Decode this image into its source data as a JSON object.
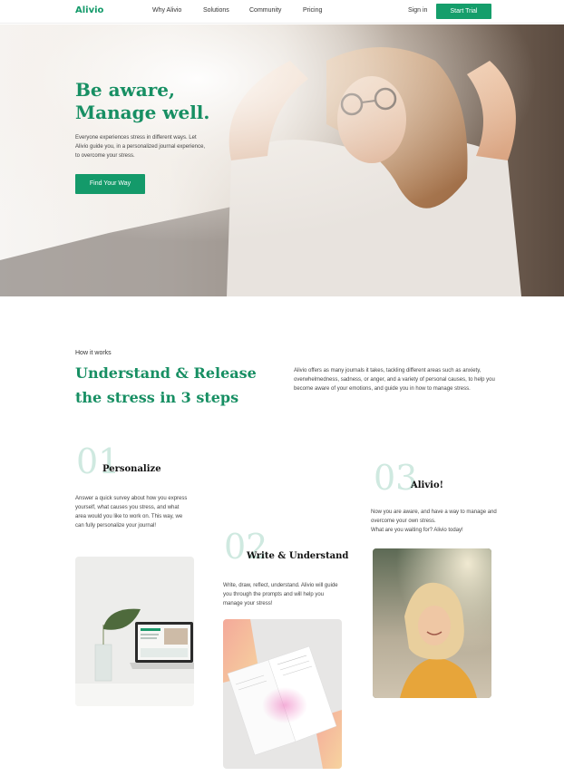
{
  "nav": {
    "logo": "Alivio",
    "links": [
      "Why Alivio",
      "Solutions",
      "Community",
      "Pricing"
    ],
    "sign_in": "Sign in",
    "start_trial": "Start Trial"
  },
  "hero": {
    "title_line1": "Be aware,",
    "title_line2": "Manage well.",
    "subtitle": "Everyone experiences stress in different ways. Let Alivio guide you, in a personalized journal experience, to overcome your stress.",
    "cta": "Find Your Way"
  },
  "how": {
    "label": "How it works",
    "title_line1": "Understand & Release",
    "title_line2": "the stress in 3 steps",
    "description": "Alivio offers as many journals it takes, tackling different areas such as anxiety, overwhelmedness, sadness, or anger, and a variety of personal causes, to help you become aware of your emotions, and guide you in how to manage stress."
  },
  "steps": [
    {
      "number": "01",
      "title": "Personalize",
      "text": "Answer a quick survey about how you express yourself, what causes you stress, and what area would you like to work on. This way, we can fully personalize your journal!"
    },
    {
      "number": "02",
      "title": "Write & Understand",
      "text": "Write, draw, reflect, understand. Alivio will guide you through the prompts and will help you manage your stress!"
    },
    {
      "number": "03",
      "title": "Alivio!",
      "text_line1": "Now you are aware, and have a way to manage and overcome your own stress.",
      "text_line2": "What are you waiting for? Alivio today!"
    }
  ],
  "colors": {
    "brand_green": "#159e6b",
    "number_tint": "#cfe9e0"
  }
}
